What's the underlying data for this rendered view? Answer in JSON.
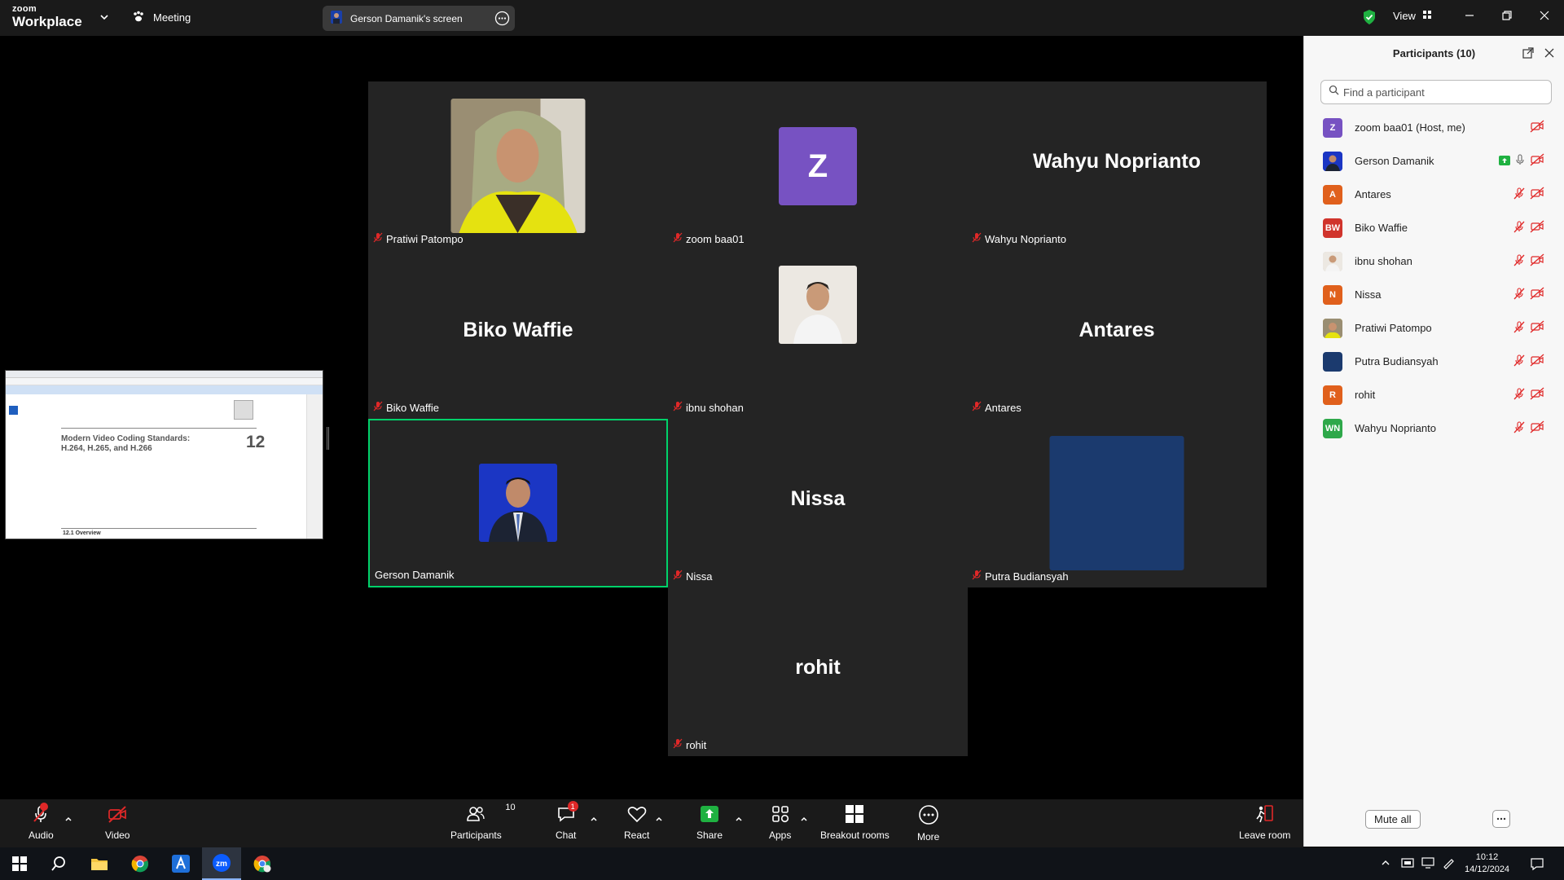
{
  "app": {
    "brand_small": "zoom",
    "brand_big": "Workplace",
    "meeting_label": "Meeting",
    "screen_share_label": "Gerson Damanik's screen",
    "view_label": "View"
  },
  "shared_screen": {
    "doc_title": "Modern Video Coding Standards: H.264, H.265, and H.266",
    "chapter_number": "12",
    "section": "12.1    Overview"
  },
  "tiles": [
    {
      "name": "Pratiwi Patompo",
      "kind": "photo",
      "mic_muted": true
    },
    {
      "name": "zoom baa01",
      "kind": "avatar",
      "avatar_letter": "Z",
      "mic_muted": true
    },
    {
      "name": "Wahyu Noprianto",
      "kind": "text",
      "display": "Wahyu Noprianto",
      "mic_muted": true
    },
    {
      "name": "Biko Waffie",
      "kind": "text",
      "display": "Biko Waffie",
      "mic_muted": true
    },
    {
      "name": "ibnu shohan",
      "kind": "photo",
      "mic_muted": true
    },
    {
      "name": "Antares",
      "kind": "text",
      "display": "Antares",
      "mic_muted": true
    },
    {
      "name": "Gerson Damanik",
      "kind": "photo",
      "mic_muted": false,
      "active_speaker": true
    },
    {
      "name": "Nissa",
      "kind": "text",
      "display": "Nissa",
      "mic_muted": true
    },
    {
      "name": "Putra Budiansyah",
      "kind": "photo",
      "mic_muted": true
    },
    {
      "name": "rohit",
      "kind": "text",
      "display": "rohit",
      "mic_muted": true
    }
  ],
  "participants_panel": {
    "title": "Participants (10)",
    "search_placeholder": "Find a participant",
    "mute_all_label": "Mute all",
    "items": [
      {
        "name": "zoom baa01 (Host, me)",
        "initials": "Z",
        "color": "#7752c2"
      },
      {
        "name": "Gerson Damanik",
        "initials": "",
        "color": "#1a3fa8"
      },
      {
        "name": "Antares",
        "initials": "A",
        "color": "#e0601c"
      },
      {
        "name": "Biko Waffie",
        "initials": "BW",
        "color": "#d0342c"
      },
      {
        "name": "ibnu shohan",
        "initials": "",
        "color": "#cfcfcf"
      },
      {
        "name": "Nissa",
        "initials": "N",
        "color": "#e0601c"
      },
      {
        "name": "Pratiwi Patompo",
        "initials": "",
        "color": "#c9b320"
      },
      {
        "name": "Putra Budiansyah",
        "initials": "",
        "color": "#1b3a6e"
      },
      {
        "name": "rohit",
        "initials": "R",
        "color": "#e0601c"
      },
      {
        "name": "Wahyu Noprianto",
        "initials": "WN",
        "color": "#2ea84a"
      }
    ]
  },
  "toolbar": {
    "audio": "Audio",
    "video": "Video",
    "participants": "Participants",
    "participants_count": "10",
    "chat": "Chat",
    "chat_badge": "1",
    "react": "React",
    "share": "Share",
    "apps": "Apps",
    "breakout": "Breakout rooms",
    "more": "More",
    "leave": "Leave room"
  },
  "taskbar": {
    "time": "10:12",
    "date": "14/12/2024"
  },
  "colors": {
    "accent_green": "#00d26a",
    "muted_red": "#e02828",
    "zoom_blue": "#0b5cff"
  }
}
